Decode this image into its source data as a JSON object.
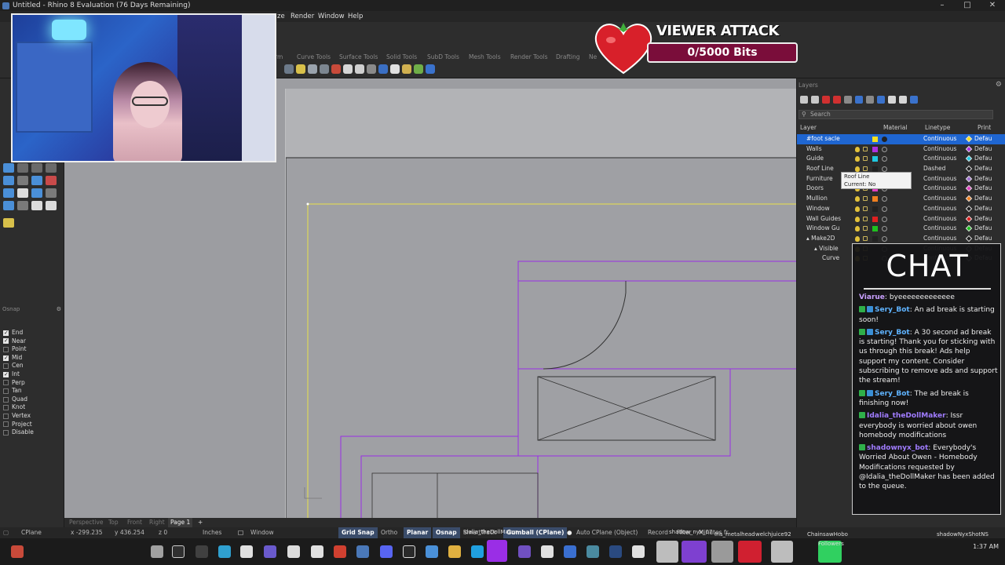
{
  "window": {
    "title": "Untitled - Rhino 8 Evaluation (76 Days Remaining)",
    "controls": [
      "–",
      "□",
      "✕"
    ]
  },
  "menubar": {
    "items": [
      "ze",
      "Render",
      "Window",
      "Help"
    ]
  },
  "toolbar_tabs": [
    "rm",
    "Curve Tools",
    "Surface Tools",
    "Solid Tools",
    "SubD Tools",
    "Mesh Tools",
    "Render Tools",
    "Drafting",
    "Ne"
  ],
  "osnap": {
    "title": "Osnap",
    "items": [
      {
        "label": "End",
        "checked": true
      },
      {
        "label": "Near",
        "checked": true
      },
      {
        "label": "Point",
        "checked": false
      },
      {
        "label": "Mid",
        "checked": true
      },
      {
        "label": "Cen",
        "checked": false
      },
      {
        "label": "Int",
        "checked": true
      },
      {
        "label": "Perp",
        "checked": false
      },
      {
        "label": "Tan",
        "checked": false
      },
      {
        "label": "Quad",
        "checked": false
      },
      {
        "label": "Knot",
        "checked": false
      },
      {
        "label": "Vertex",
        "checked": false
      },
      {
        "label": "Project",
        "checked": false
      },
      {
        "label": "Disable",
        "checked": false
      }
    ]
  },
  "viewport_tabs": {
    "items": [
      "Perspective",
      "Top",
      "Front",
      "Right"
    ],
    "active": "Page 1",
    "add": "+"
  },
  "layers": {
    "title": "Layers",
    "search_placeholder": "Search",
    "columns": {
      "layer": "Layer",
      "material": "Material",
      "linetype": "Linetype",
      "print": "Print"
    },
    "rows": [
      {
        "name": "#foot sacle",
        "color": "#f5e020",
        "linetype": "Continuous",
        "print": "Defau",
        "pcolor": "#f5e020",
        "selected": true,
        "indent": 0
      },
      {
        "name": "Walls",
        "color": "#b030e0",
        "linetype": "Continuous",
        "print": "Defau",
        "pcolor": "#b030e0",
        "selected": false,
        "indent": 0
      },
      {
        "name": "Guide",
        "color": "#20c8e0",
        "linetype": "Continuous",
        "print": "Defau",
        "pcolor": "#20c8e0",
        "selected": false,
        "indent": 0
      },
      {
        "name": "Roof Line",
        "color": "#222222",
        "linetype": "Dashed",
        "print": "Defau",
        "pcolor": "#222222",
        "selected": false,
        "indent": 0
      },
      {
        "name": "Furniture",
        "color": "#a070d0",
        "linetype": "Continuous",
        "print": "Defau",
        "pcolor": "#a070d0",
        "selected": false,
        "indent": 0
      },
      {
        "name": "Doors",
        "color": "#e040c0",
        "linetype": "Continuous",
        "print": "Defau",
        "pcolor": "#e040c0",
        "selected": false,
        "indent": 0
      },
      {
        "name": "Mullion",
        "color": "#f08020",
        "linetype": "Continuous",
        "print": "Defau",
        "pcolor": "#f08020",
        "selected": false,
        "indent": 0
      },
      {
        "name": "Window",
        "color": "#222222",
        "linetype": "Continuous",
        "print": "Defau",
        "pcolor": "#222222",
        "selected": false,
        "indent": 0
      },
      {
        "name": "Wall Guides",
        "color": "#e02020",
        "linetype": "Continuous",
        "print": "Defau",
        "pcolor": "#e02020",
        "selected": false,
        "indent": 0
      },
      {
        "name": "Window Gu",
        "color": "#20c020",
        "linetype": "Continuous",
        "print": "Defau",
        "pcolor": "#20c020",
        "selected": false,
        "indent": 0
      },
      {
        "name": "▴ Make2D",
        "color": "#222222",
        "linetype": "Continuous",
        "print": "Defau",
        "pcolor": "#222222",
        "selected": false,
        "indent": 0
      },
      {
        "name": "▴ Visible",
        "color": "#222222",
        "linetype": "Continuous",
        "print": "Defau",
        "pcolor": "#222222",
        "selected": false,
        "indent": 1
      },
      {
        "name": "Curve",
        "color": "#222222",
        "linetype": "Continuous",
        "print": "Defau",
        "pcolor": "#222222",
        "selected": false,
        "indent": 2
      }
    ],
    "tooltip": {
      "line1": "Roof Line",
      "line2": "Current: No"
    }
  },
  "statusbar": {
    "cplane": "CPlane",
    "x": "x -299.235",
    "y": "y 436.254",
    "z": "z 0",
    "units": "Inches",
    "layer_name": "Window",
    "grid_snap": "Grid Snap",
    "ortho": "Ortho",
    "planar": "Planar",
    "osnap": "Osnap",
    "smarttrack": "SmartTrack",
    "gumball": "Gumball (CPlane)",
    "auto_cplane": "Auto CPlane (Object)",
    "record": "Record",
    "filter": "Filter",
    "minutes": "Minutes fr"
  },
  "taskbar": {
    "labels": [
      "Idalia_theDollMaker",
      "shadow_nyx_07",
      "Iris_metalhead",
      "welchjuice92",
      "ChainsawHobo",
      "Followers",
      "shadowNyxShotNS"
    ],
    "clock": "1:37 AM"
  },
  "viewer_attack": {
    "title": "VIEWER ATTACK",
    "progress_label": "0/5000 Bits",
    "current": 0,
    "goal": 5000
  },
  "chat": {
    "title": "CHAT",
    "messages": [
      {
        "user": "Viarue",
        "text": "byeeeeeeeeeeeee",
        "color": "#c9a0ff",
        "badges": []
      },
      {
        "user": "Sery_Bot",
        "text": "An ad break is starting soon!",
        "color": "#5fb3ff",
        "badges": [
          "#2faf4a",
          "#3a8fd6"
        ]
      },
      {
        "user": "Sery_Bot",
        "text": "A 30 second ad break is starting! Thank you for sticking with us through this break! Ads help support my content. Consider subscribing to remove ads and support the stream!",
        "color": "#5fb3ff",
        "badges": [
          "#2faf4a",
          "#3a8fd6"
        ]
      },
      {
        "user": "Sery_Bot",
        "text": "The ad break is finishing now!",
        "color": "#5fb3ff",
        "badges": [
          "#2faf4a",
          "#3a8fd6"
        ]
      },
      {
        "user": "Idalia_theDollMaker",
        "text": "Issr everybody is worried about owen homebody modifications",
        "color": "#a07cff",
        "badges": [
          "#2faf4a"
        ]
      },
      {
        "user": "shadownyx_bot",
        "text": "Everybody's Worried About Owen - Homebody Modifications requested by @Idalia_theDollMaker has been added to the queue.",
        "color": "#a07cff",
        "badges": [
          "#2faf4a"
        ]
      }
    ]
  }
}
